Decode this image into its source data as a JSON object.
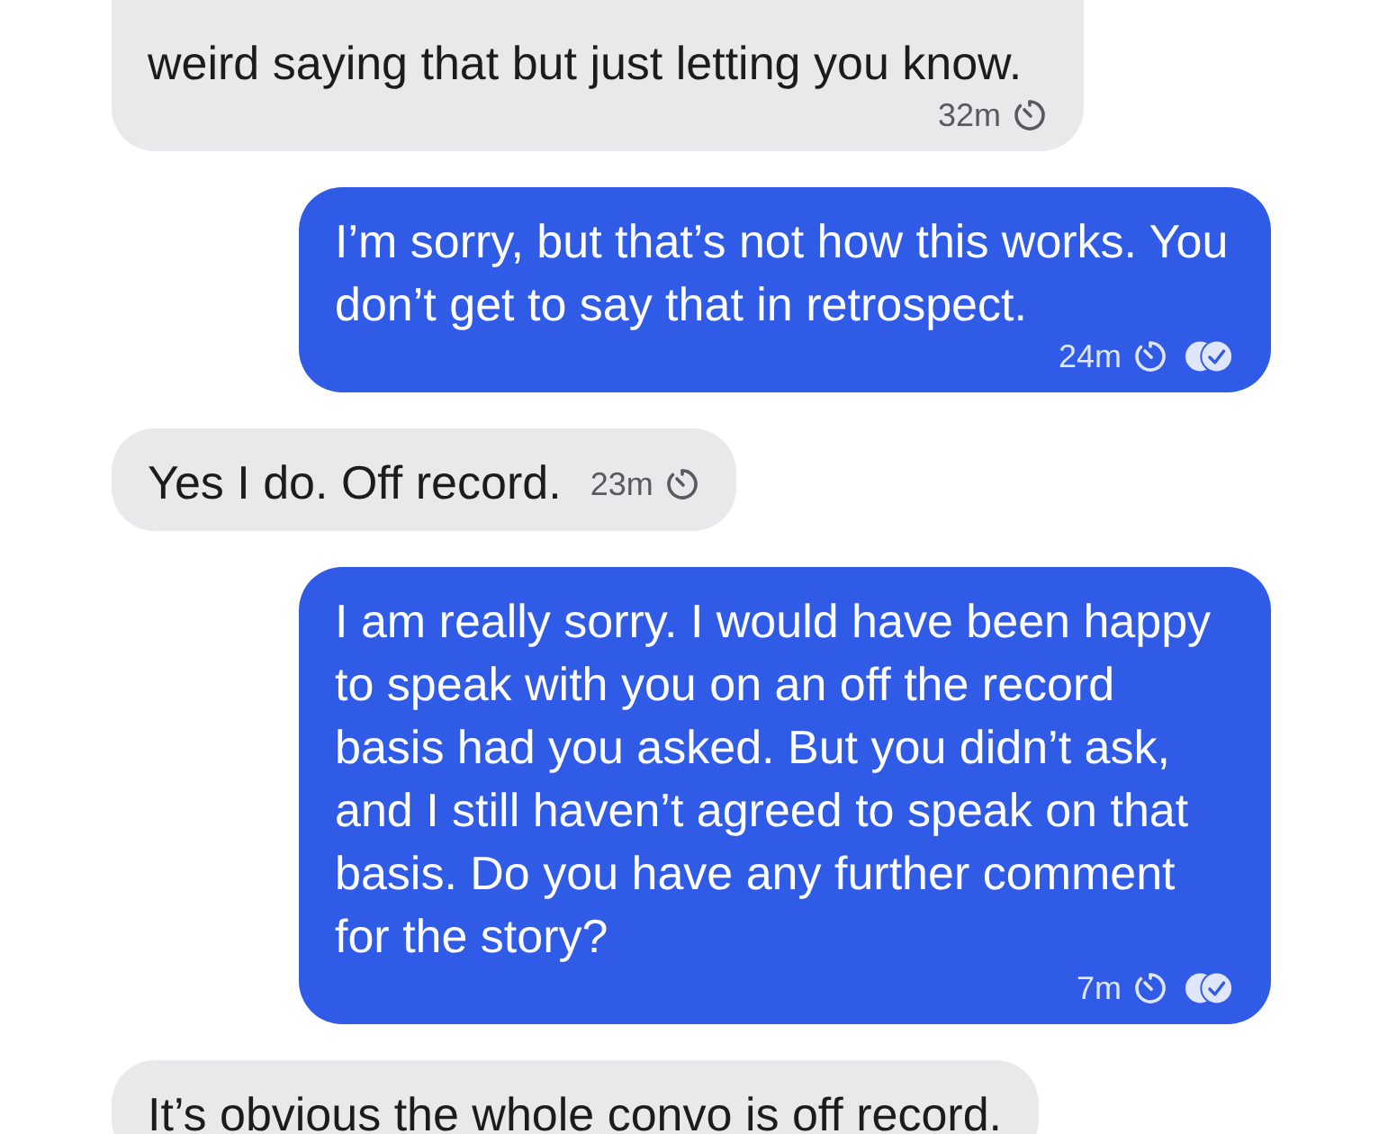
{
  "messages": [
    {
      "kind": "received",
      "text": "weird saying that but just letting you know.",
      "time": "32m",
      "timer": true,
      "read": false
    },
    {
      "kind": "sent",
      "text": "I’m sorry, but that’s not how this works. You don’t get to say that in retrospect.",
      "time": "24m",
      "timer": true,
      "read": true
    },
    {
      "kind": "received",
      "text": "Yes I do. Off record.",
      "time": "23m",
      "timer": true,
      "read": false
    },
    {
      "kind": "sent",
      "text": "I am really sorry. I would have been happy to speak with you on an off the record basis had you asked. But you didn’t ask, and I still haven’t agreed to speak on that basis. Do you have any further comment for the story?",
      "time": "7m",
      "timer": true,
      "read": true
    },
    {
      "kind": "received",
      "text": "It’s obvious the whole convo is off record."
    }
  ]
}
